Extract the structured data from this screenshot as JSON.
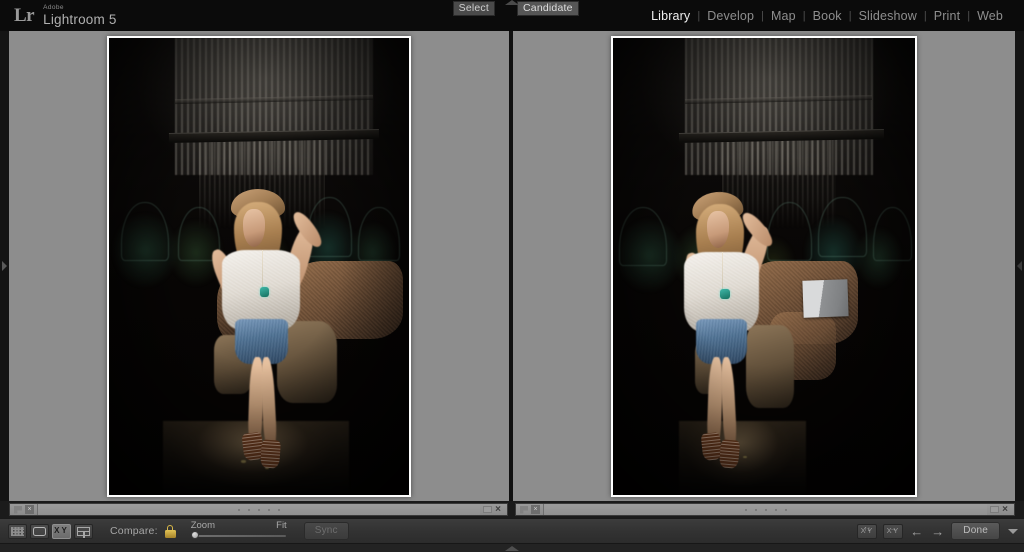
{
  "app": {
    "brand_short": "Lr",
    "brand_line1": "Adobe",
    "brand_line2": "Lightroom 5",
    "accent_lock_color": "#d9b949",
    "workspace_bg": "#8d8d8d",
    "chrome_bg": "#0b0b0b"
  },
  "modules": {
    "items": [
      {
        "label": "Library",
        "active": true
      },
      {
        "label": "Develop",
        "active": false
      },
      {
        "label": "Map",
        "active": false
      },
      {
        "label": "Book",
        "active": false
      },
      {
        "label": "Slideshow",
        "active": false
      },
      {
        "label": "Print",
        "active": false
      },
      {
        "label": "Web",
        "active": false
      }
    ],
    "separator": "|"
  },
  "compare_view": {
    "select_label": "Select",
    "candidate_label": "Candidate",
    "left_pane": {
      "name": "select-photo",
      "orientation": "portrait",
      "description": "Blonde woman in white lace blouse, denim shorts, tan hat and strappy sandals posing in a dark industrial space with graffiti wall"
    },
    "right_pane": {
      "name": "candidate-photo",
      "orientation": "portrait",
      "description": "Same model, alternate frame shifted left with head tilted and a grey and white board leaning at right"
    }
  },
  "info_bar": {
    "flag_icon": "flag-icon",
    "reject_icon": "reject-x-icon",
    "close_icon": "×",
    "rating_dots": 5
  },
  "toolbar": {
    "view_modes": [
      {
        "name": "grid-view",
        "icon": "grid-icon",
        "active": false
      },
      {
        "name": "loupe-view",
        "icon": "loupe-icon",
        "active": false
      },
      {
        "name": "compare-view",
        "icon": "xy-compare-icon",
        "label": "XY",
        "active": true
      },
      {
        "name": "survey-view",
        "icon": "survey-icon",
        "active": false
      }
    ],
    "compare_label": "Compare:",
    "lock_icon": "lock-closed-icon",
    "zoom_label": "Zoom",
    "fit_label": "Fit",
    "zoom_value": 0,
    "sync_label": "Sync",
    "sync_enabled": false,
    "swap_label": "XY",
    "make_select_label": "XY",
    "prev_arrow": "←",
    "next_arrow": "→",
    "done_label": "Done",
    "options_caret": "▼"
  },
  "edges": {
    "top_toggle": "show-top-panel-arrow",
    "left_toggle": "show-left-panel-arrow",
    "right_toggle": "show-right-panel-arrow",
    "bottom_toggle": "show-filmstrip-arrow"
  }
}
